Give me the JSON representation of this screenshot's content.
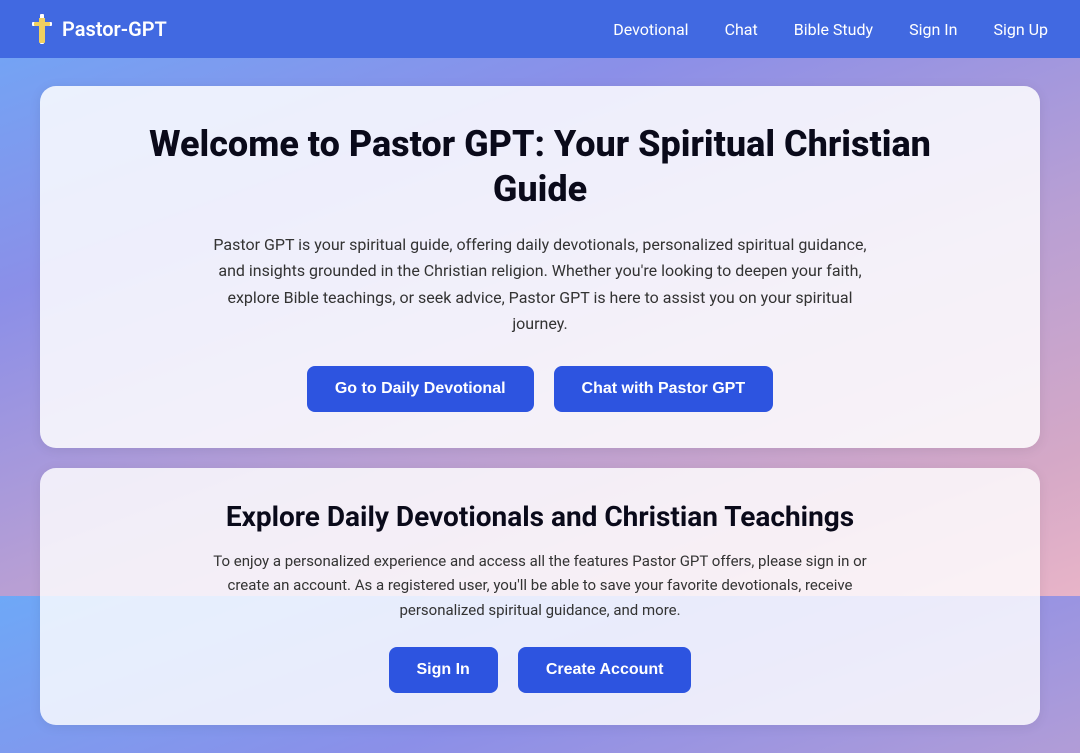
{
  "navbar": {
    "brand_name": "Pastor-GPT",
    "links": [
      {
        "label": "Devotional",
        "name": "nav-devotional"
      },
      {
        "label": "Chat",
        "name": "nav-chat"
      },
      {
        "label": "Bible Study",
        "name": "nav-bible-study"
      },
      {
        "label": "Sign In",
        "name": "nav-sign-in"
      },
      {
        "label": "Sign Up",
        "name": "nav-sign-up"
      }
    ]
  },
  "hero": {
    "title": "Welcome to Pastor GPT: Your Spiritual Christian Guide",
    "description": "Pastor GPT is your spiritual guide, offering daily devotionals, personalized spiritual guidance, and insights grounded in the Christian religion. Whether you're looking to deepen your faith, explore Bible teachings, or seek advice, Pastor GPT is here to assist you on your spiritual journey.",
    "button_devotional": "Go to Daily Devotional",
    "button_chat": "Chat with Pastor GPT"
  },
  "secondary": {
    "title": "Explore Daily Devotionals and Christian Teachings",
    "description": "To enjoy a personalized experience and access all the features Pastor GPT offers, please sign in or create an account. As a registered user, you'll be able to save your favorite devotionals, receive personalized spiritual guidance, and more.",
    "button_sign_in": "Sign In",
    "button_create": "Create Account"
  }
}
